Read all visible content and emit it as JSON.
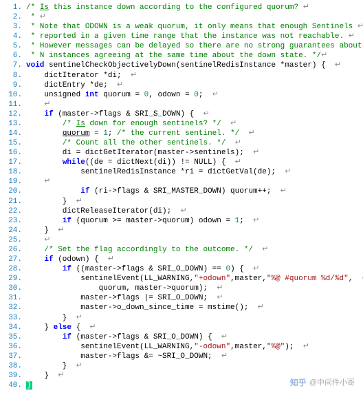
{
  "watermark": {
    "logo": "知乎",
    "author": "@中间件小哥"
  },
  "lines": [
    {
      "n": "1.",
      "tokens": [
        [
          "cm",
          "/* "
        ],
        [
          "cm under",
          "Is"
        ],
        [
          "cm",
          " this instance down according to the configured quorum? "
        ],
        [
          "pl",
          "↵"
        ]
      ]
    },
    {
      "n": "2.",
      "tokens": [
        [
          "cm",
          " * "
        ],
        [
          "pl",
          "↵"
        ]
      ]
    },
    {
      "n": "3.",
      "tokens": [
        [
          "cm",
          " * Note that ODOWN is a weak quorum, it only means that enough Sentinels "
        ],
        [
          "pl",
          "↵"
        ]
      ]
    },
    {
      "n": "4.",
      "tokens": [
        [
          "cm",
          " * reported in a given time range that the instance was not reachable. "
        ],
        [
          "pl",
          "↵"
        ]
      ]
    },
    {
      "n": "5.",
      "tokens": [
        [
          "cm",
          " * However messages can be delayed so there are no strong guarantees about "
        ],
        [
          "pl",
          "↵"
        ]
      ]
    },
    {
      "n": "6.",
      "tokens": [
        [
          "cm",
          " * N instances agreeing at the same time about the down state. */"
        ],
        [
          "pl",
          "↵"
        ]
      ]
    },
    {
      "n": "7.",
      "tokens": [
        [
          "kw",
          "void"
        ],
        [
          "id",
          " sentinelCheckObjectivelyDown(sentinelRedisInstance *master) {  "
        ],
        [
          "pl",
          "↵"
        ]
      ]
    },
    {
      "n": "8.",
      "tokens": [
        [
          "id",
          "    dictIterator *di;  "
        ],
        [
          "pl",
          "↵"
        ]
      ]
    },
    {
      "n": "9.",
      "tokens": [
        [
          "id",
          "    dictEntry *de;  "
        ],
        [
          "pl",
          "↵"
        ]
      ]
    },
    {
      "n": "10.",
      "tokens": [
        [
          "id",
          "    unsigned "
        ],
        [
          "kw",
          "int"
        ],
        [
          "id",
          " quorum = "
        ],
        [
          "nm",
          "0"
        ],
        [
          "id",
          ", odown = "
        ],
        [
          "nm",
          "0"
        ],
        [
          "id",
          ";  "
        ],
        [
          "pl",
          "↵"
        ]
      ]
    },
    {
      "n": "11.",
      "tokens": [
        [
          "id",
          "    "
        ],
        [
          "pl",
          "↵"
        ]
      ]
    },
    {
      "n": "12.",
      "tokens": [
        [
          "id",
          "    "
        ],
        [
          "kw",
          "if"
        ],
        [
          "id",
          " (master->flags & SRI_S_DOWN) {  "
        ],
        [
          "pl",
          "↵"
        ]
      ]
    },
    {
      "n": "13.",
      "tokens": [
        [
          "id",
          "        "
        ],
        [
          "cm",
          "/* "
        ],
        [
          "cm under",
          "Is"
        ],
        [
          "cm",
          " down for enough sentinels? */"
        ],
        [
          "id",
          "  "
        ],
        [
          "pl",
          "↵"
        ]
      ]
    },
    {
      "n": "14.",
      "tokens": [
        [
          "id",
          "        "
        ],
        [
          "id under",
          "quorum"
        ],
        [
          "id",
          " = "
        ],
        [
          "nm",
          "1"
        ],
        [
          "id",
          "; "
        ],
        [
          "cm",
          "/* the current sentinel. */"
        ],
        [
          "id",
          "  "
        ],
        [
          "pl",
          "↵"
        ]
      ]
    },
    {
      "n": "15.",
      "tokens": [
        [
          "id",
          "        "
        ],
        [
          "cm",
          "/* Count all the other sentinels. */"
        ],
        [
          "id",
          "  "
        ],
        [
          "pl",
          "↵"
        ]
      ]
    },
    {
      "n": "16.",
      "tokens": [
        [
          "id",
          "        di = dictGetIterator(master->sentinels);  "
        ],
        [
          "pl",
          "↵"
        ]
      ]
    },
    {
      "n": "17.",
      "tokens": [
        [
          "id",
          "        "
        ],
        [
          "kw",
          "while"
        ],
        [
          "id",
          "((de = dictNext(di)) != NULL) {  "
        ],
        [
          "pl",
          "↵"
        ]
      ]
    },
    {
      "n": "18.",
      "tokens": [
        [
          "id",
          "            sentinelRedisInstance *ri = dictGetVal(de);  "
        ],
        [
          "pl",
          "↵"
        ]
      ]
    },
    {
      "n": "19.",
      "tokens": [
        [
          "id",
          "    "
        ],
        [
          "pl",
          "↵"
        ]
      ]
    },
    {
      "n": "20.",
      "tokens": [
        [
          "id",
          "            "
        ],
        [
          "kw",
          "if"
        ],
        [
          "id",
          " (ri->flags & SRI_MASTER_DOWN) quorum++;  "
        ],
        [
          "pl",
          "↵"
        ]
      ]
    },
    {
      "n": "21.",
      "tokens": [
        [
          "id",
          "        }  "
        ],
        [
          "pl",
          "↵"
        ]
      ]
    },
    {
      "n": "22.",
      "tokens": [
        [
          "id",
          "        dictReleaseIterator(di);  "
        ],
        [
          "pl",
          "↵"
        ]
      ]
    },
    {
      "n": "23.",
      "tokens": [
        [
          "id",
          "        "
        ],
        [
          "kw",
          "if"
        ],
        [
          "id",
          " (quorum >= master->quorum) odown = "
        ],
        [
          "nm",
          "1"
        ],
        [
          "id",
          ";  "
        ],
        [
          "pl",
          "↵"
        ]
      ]
    },
    {
      "n": "24.",
      "tokens": [
        [
          "id",
          "    }  "
        ],
        [
          "pl",
          "↵"
        ]
      ]
    },
    {
      "n": "25.",
      "tokens": [
        [
          "id",
          "    "
        ],
        [
          "pl",
          "↵"
        ]
      ]
    },
    {
      "n": "26.",
      "tokens": [
        [
          "id",
          "    "
        ],
        [
          "cm",
          "/* Set the flag accordingly to the outcome. */"
        ],
        [
          "id",
          "  "
        ],
        [
          "pl",
          "↵"
        ]
      ]
    },
    {
      "n": "27.",
      "tokens": [
        [
          "id",
          "    "
        ],
        [
          "kw",
          "if"
        ],
        [
          "id",
          " (odown) {  "
        ],
        [
          "pl",
          "↵"
        ]
      ]
    },
    {
      "n": "28.",
      "tokens": [
        [
          "id",
          "        "
        ],
        [
          "kw",
          "if"
        ],
        [
          "id",
          " ((master->flags & SRI_O_DOWN) == "
        ],
        [
          "nm",
          "0"
        ],
        [
          "id",
          ") {  "
        ],
        [
          "pl",
          "↵"
        ]
      ]
    },
    {
      "n": "29.",
      "tokens": [
        [
          "id",
          "            sentinelEvent(LL_WARNING,"
        ],
        [
          "str",
          "\"+odown\""
        ],
        [
          "id",
          ",master,"
        ],
        [
          "str",
          "\"%@ #quorum %d/%d\""
        ],
        [
          "id",
          ",  "
        ],
        [
          "pl",
          "↵"
        ]
      ]
    },
    {
      "n": "30.",
      "tokens": [
        [
          "id",
          "                quorum, master->quorum);  "
        ],
        [
          "pl",
          "↵"
        ]
      ]
    },
    {
      "n": "31.",
      "tokens": [
        [
          "id",
          "            master->flags |= SRI_O_DOWN;  "
        ],
        [
          "pl",
          "↵"
        ]
      ]
    },
    {
      "n": "32.",
      "tokens": [
        [
          "id",
          "            master->o_down_since_time = mstime();  "
        ],
        [
          "pl",
          "↵"
        ]
      ]
    },
    {
      "n": "33.",
      "tokens": [
        [
          "id",
          "        }  "
        ],
        [
          "pl",
          "↵"
        ]
      ]
    },
    {
      "n": "34.",
      "tokens": [
        [
          "id",
          "    } "
        ],
        [
          "kw",
          "else"
        ],
        [
          "id",
          " {  "
        ],
        [
          "pl",
          "↵"
        ]
      ]
    },
    {
      "n": "35.",
      "tokens": [
        [
          "id",
          "        "
        ],
        [
          "kw",
          "if"
        ],
        [
          "id",
          " (master->flags & SRI_O_DOWN) {  "
        ],
        [
          "pl",
          "↵"
        ]
      ]
    },
    {
      "n": "36.",
      "tokens": [
        [
          "id",
          "            sentinelEvent(LL_WARNING,"
        ],
        [
          "str",
          "\"-odown\""
        ],
        [
          "id",
          ",master,"
        ],
        [
          "str",
          "\"%@\""
        ],
        [
          "id",
          ");  "
        ],
        [
          "pl",
          "↵"
        ]
      ]
    },
    {
      "n": "37.",
      "tokens": [
        [
          "id",
          "            master->flags &= ~SRI_O_DOWN;  "
        ],
        [
          "pl",
          "↵"
        ]
      ]
    },
    {
      "n": "38.",
      "tokens": [
        [
          "id",
          "        }  "
        ],
        [
          "pl",
          "↵"
        ]
      ]
    },
    {
      "n": "39.",
      "tokens": [
        [
          "id",
          "    }  "
        ],
        [
          "pl",
          "↵"
        ]
      ]
    },
    {
      "n": "40.",
      "tokens": [
        [
          "brace-hl",
          "}"
        ],
        [
          "id",
          "  "
        ]
      ]
    }
  ]
}
